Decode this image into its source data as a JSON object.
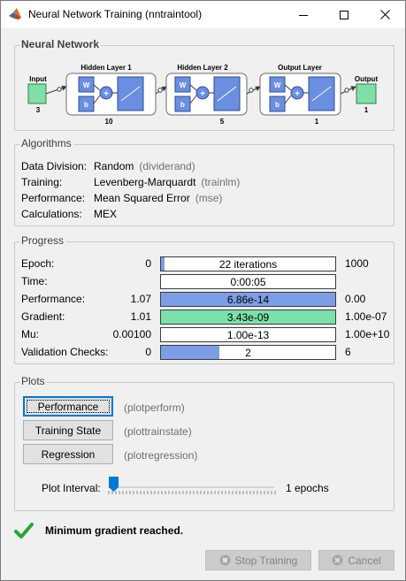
{
  "window": {
    "title": "Neural Network Training (nntraintool)"
  },
  "sections": {
    "network": "Neural Network",
    "algorithms": "Algorithms",
    "progress": "Progress",
    "plots": "Plots"
  },
  "network": {
    "input_label": "Input",
    "input_size": "3",
    "hidden1_label": "Hidden Layer 1",
    "hidden1_size": "10",
    "hidden2_label": "Hidden Layer 2",
    "hidden2_size": "5",
    "output_layer_label": "Output Layer",
    "output_layer_size": "1",
    "output_label": "Output",
    "output_size": "1",
    "weight_label": "W",
    "bias_label": "b",
    "sum_symbol": "+"
  },
  "algorithms": [
    {
      "label": "Data Division:",
      "value": "Random",
      "func": "(dividerand)"
    },
    {
      "label": "Training:",
      "value": "Levenberg-Marquardt",
      "func": "(trainlm)"
    },
    {
      "label": "Performance:",
      "value": "Mean Squared Error",
      "func": "(mse)"
    },
    {
      "label": "Calculations:",
      "value": "MEX",
      "func": ""
    }
  ],
  "progress": [
    {
      "label": "Epoch:",
      "min": "0",
      "bar_text": "22 iterations",
      "max": "1000",
      "fill_fraction": 0.022,
      "fill_color": "#7b9ee6"
    },
    {
      "label": "Time:",
      "min": "",
      "bar_text": "0:00:05",
      "max": "",
      "fill_fraction": 0,
      "fill_color": "#7b9ee6"
    },
    {
      "label": "Performance:",
      "min": "1.07",
      "bar_text": "6.86e-14",
      "max": "0.00",
      "fill_fraction": 1.0,
      "fill_color": "#7b9ee6"
    },
    {
      "label": "Gradient:",
      "min": "1.01",
      "bar_text": "3.43e-09",
      "max": "1.00e-07",
      "fill_fraction": 1.0,
      "fill_color": "#7be0ab"
    },
    {
      "label": "Mu:",
      "min": "0.00100",
      "bar_text": "1.00e-13",
      "max": "1.00e+10",
      "fill_fraction": 0,
      "fill_color": "#7b9ee6"
    },
    {
      "label": "Validation Checks:",
      "min": "0",
      "bar_text": "2",
      "max": "6",
      "fill_fraction": 0.333,
      "fill_color": "#7b9ee6"
    }
  ],
  "plots": [
    {
      "label": "Performance",
      "func": "(plotperform)"
    },
    {
      "label": "Training State",
      "func": "(plottrainstate)"
    },
    {
      "label": "Regression",
      "func": "(plotregression)"
    }
  ],
  "plot_interval": {
    "label": "Plot Interval:",
    "value": "1 epochs",
    "position_fraction": 0.0
  },
  "status": {
    "message": "Minimum gradient reached."
  },
  "buttons": {
    "stop": "Stop Training",
    "cancel": "Cancel"
  },
  "colors": {
    "progress_blue": "#7b9ee6",
    "gradient_green": "#7be0ab",
    "layer_blue": "#6a8ee0",
    "io_green": "#7fe0a6"
  }
}
